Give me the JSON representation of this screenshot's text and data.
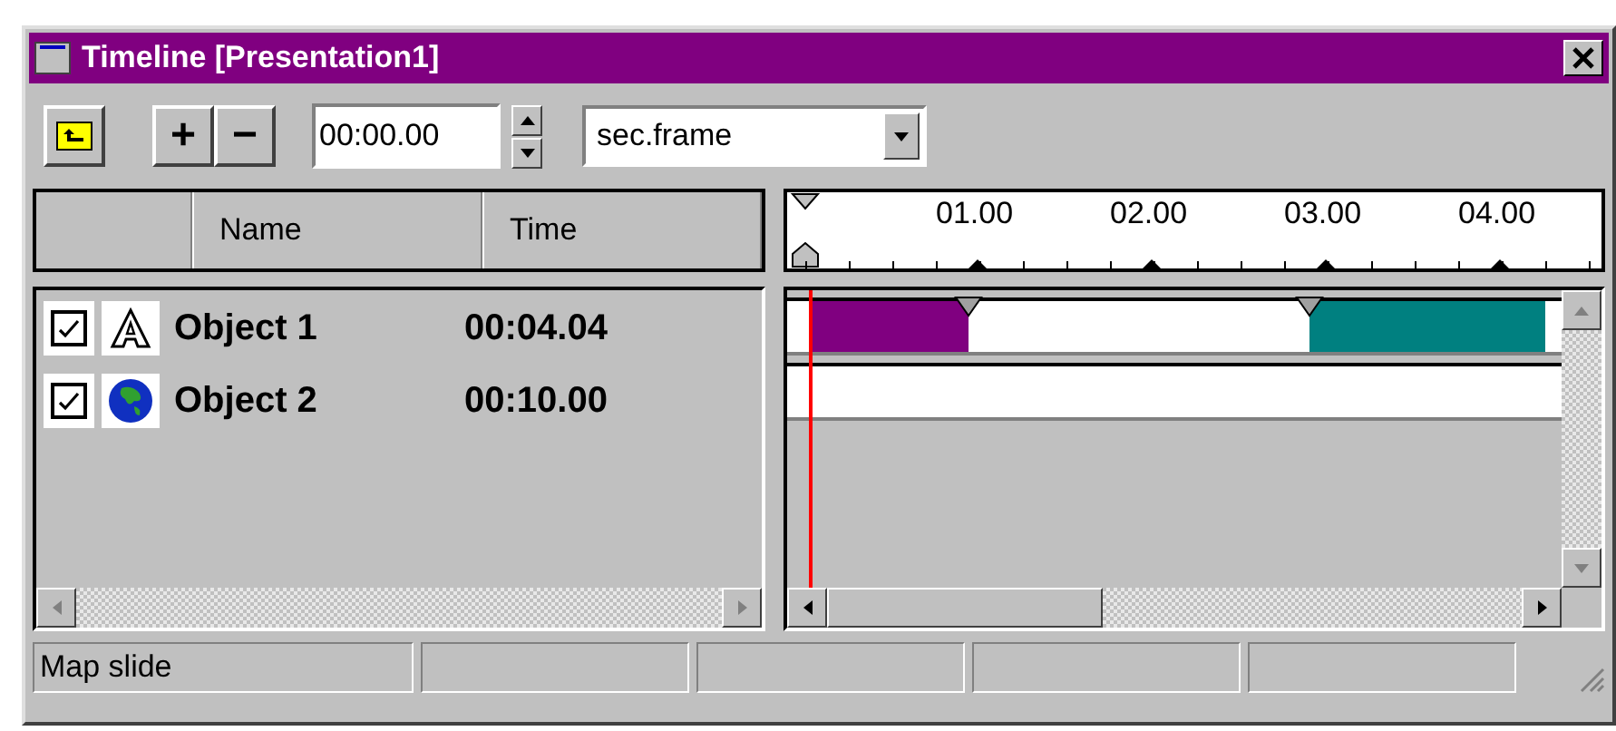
{
  "window": {
    "title": "Timeline [Presentation1]"
  },
  "toolbar": {
    "time_value": "00:00.00",
    "units": "sec.frame",
    "add_label": "+",
    "remove_label": "−"
  },
  "columns": [
    "Name",
    "Time"
  ],
  "ruler": {
    "labels": [
      "01.00",
      "02.00",
      "03.00",
      "04.00"
    ]
  },
  "objects": [
    {
      "name": "Object 1",
      "time": "00:04.04",
      "checked": true,
      "kind": "text",
      "segments": [
        {
          "color": "#800080"
        },
        {
          "color": "#008080"
        }
      ]
    },
    {
      "name": "Object 2",
      "time": "00:10.00",
      "checked": true,
      "kind": "globe"
    }
  ],
  "status_bar": {
    "text": "Map slide"
  }
}
